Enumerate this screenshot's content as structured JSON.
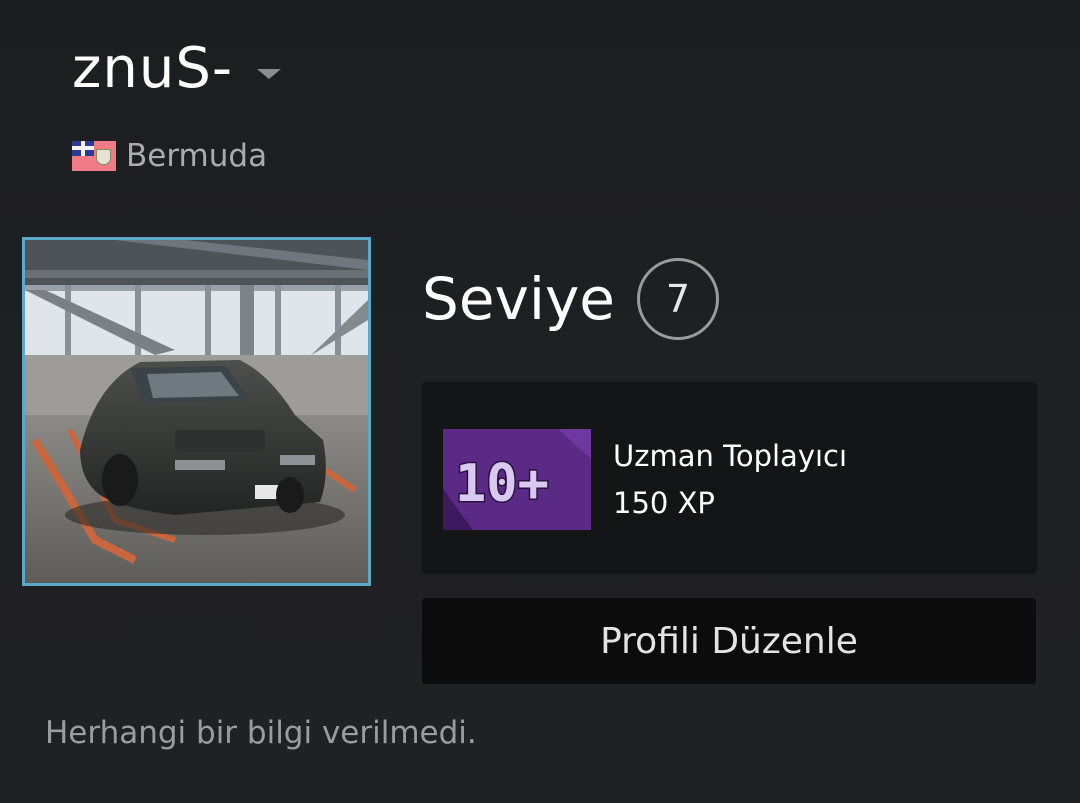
{
  "profile": {
    "persona_name": "znuS-",
    "location": "Bermuda",
    "summary": "Herhangi bir bilgi verilmedi."
  },
  "level": {
    "label": "Seviye",
    "value": "7"
  },
  "badge": {
    "name": "Uzman Toplayıcı",
    "xp": "150 XP",
    "icon_text": "10+",
    "icon_color": "#5a2a86"
  },
  "actions": {
    "edit_profile_label": "Profili Düzenle"
  },
  "colors": {
    "background": "#1e1f22",
    "avatar_border": "#5ba8c8",
    "card_background": "#141517"
  }
}
